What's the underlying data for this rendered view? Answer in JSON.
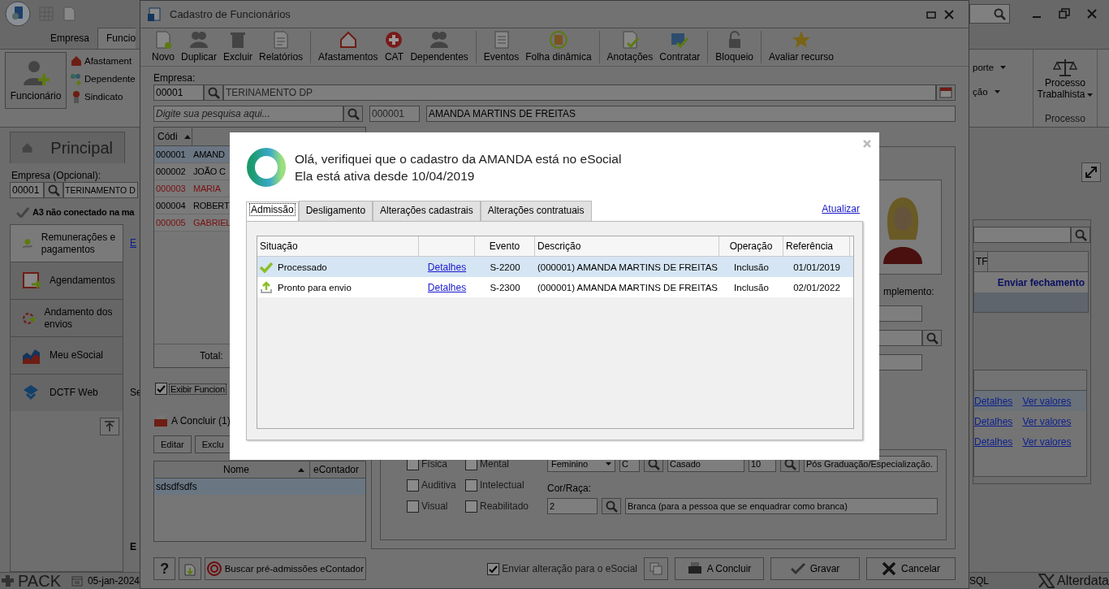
{
  "app": {
    "ribbon_tabs": [
      {
        "label": "Empresa",
        "selected": false
      },
      {
        "label": "Funcio",
        "selected": true
      }
    ],
    "ribbon_left": {
      "big_button": "Funcionário",
      "items": [
        "Afastament",
        "Dependente",
        "Sindicato"
      ]
    },
    "ribbon_right": {
      "items": [
        "porte",
        "ção"
      ],
      "big_button": "Processo Trabalhista",
      "group": "Processo"
    },
    "panel": {
      "title": "Principal",
      "company_label": "Empresa (Opcional):",
      "company_code": "00001",
      "company_name": "TERINAMENTO D",
      "status": "A3 não conectado na ma",
      "nav": [
        {
          "label": "Remunerações e pagamentos",
          "selected": true
        },
        {
          "label": "Agendamentos",
          "selected": false
        },
        {
          "label": "Andamento dos envios",
          "selected": false
        },
        {
          "label": "Meu eSocial",
          "selected": false
        },
        {
          "label": "DCTF Web",
          "selected": false
        }
      ],
      "fragments": [
        "E",
        "Se",
        "E"
      ]
    },
    "right_panel": {
      "columns": [
        "TF"
      ],
      "action": "Enviar fechamento",
      "links": [
        {
          "details": "Detalhes",
          "values": "Ver valores"
        },
        {
          "details": "Detalhes",
          "values": "Ver valores"
        },
        {
          "details": "Detalhes",
          "values": "Ver valores"
        }
      ]
    },
    "status_bar": {
      "brand": "PACK",
      "date": "05-jan-2024",
      "db": "SQL",
      "vendor": "Alterdata"
    }
  },
  "window": {
    "title": "Cadastro de Funcionários",
    "toolbar": [
      {
        "label": "Novo",
        "divider_before": false
      },
      {
        "label": "Duplicar",
        "divider_before": false
      },
      {
        "label": "Excluir",
        "divider_before": false
      },
      {
        "label": "Relatórios",
        "divider_before": false
      },
      {
        "label": "Afastamentos",
        "divider_before": true
      },
      {
        "label": "CAT",
        "divider_before": false
      },
      {
        "label": "Dependentes",
        "divider_before": false
      },
      {
        "label": "Eventos",
        "divider_before": true
      },
      {
        "label": "Folha dinâmica",
        "divider_before": false
      },
      {
        "label": "Anotações",
        "divider_before": true
      },
      {
        "label": "Contratar",
        "divider_before": false
      },
      {
        "label": "Bloqueio",
        "divider_before": true
      },
      {
        "label": "Avaliar recurso",
        "divider_before": true
      }
    ],
    "company_label": "Empresa:",
    "company_code": "00001",
    "company_name": "TERINAMENTO DP",
    "search_placeholder": "Digite sua pesquisa aqui...",
    "employee_code": "000001",
    "employee_name": "AMANDA MARTINS DE FREITAS",
    "list": {
      "column": "Códi",
      "rows": [
        {
          "code": "000001",
          "name": "AMAND",
          "color": "#000000",
          "selected": true
        },
        {
          "code": "000002",
          "name": "JOÃO C",
          "color": "#000000",
          "selected": false
        },
        {
          "code": "000003",
          "name": "MARIA",
          "color": "#7a1010",
          "selected": false
        },
        {
          "code": "000004",
          "name": "ROBERT",
          "color": "#000000",
          "selected": false
        },
        {
          "code": "000005",
          "name": "GABRIEL",
          "color": "#7a1010",
          "selected": false
        }
      ],
      "total": "Total:"
    },
    "show_checkbox": {
      "label": "Exibir Funcion",
      "checked": true
    },
    "pending": {
      "title": "A Concluir (1)",
      "buttons": [
        "Editar",
        "Exclu"
      ],
      "columns": [
        "Nome",
        "eContador"
      ],
      "rows": [
        "sdsdfsdfs"
      ]
    },
    "footer_left": {
      "help": "?",
      "import_button": "Buscar pré-admissões eContador"
    },
    "photo_label": "mplemento:",
    "form": {
      "row1": [
        {
          "label": "Física",
          "checked": false
        },
        {
          "label": "Mental",
          "checked": false
        }
      ],
      "sex": "Feminino",
      "civil_code": "C",
      "civil": "Casado",
      "education_code": "10",
      "education": "Pós Graduação/Especialização.",
      "row2": [
        {
          "label": "Auditiva",
          "checked": false
        },
        {
          "label": "Intelectual",
          "checked": false
        }
      ],
      "race_label": "Cor/Raça:",
      "row3": [
        {
          "label": "Visual",
          "checked": false
        },
        {
          "label": "Reabilitado",
          "checked": false
        }
      ],
      "race_code": "2",
      "race": "Branca (para a pessoa que se enquadrar como branca)"
    },
    "footer": {
      "send_checkbox": {
        "label": "Enviar alteração para o eSocial",
        "checked": true
      },
      "buttons": [
        "A Concluir",
        "Gravar",
        "Cancelar"
      ]
    }
  },
  "dialog": {
    "message": [
      "Olá, verifiquei que o cadastro da AMANDA está no eSocial",
      "Ela está ativa desde 10/04/2019"
    ],
    "tabs": [
      {
        "label": "Admissão",
        "selected": true
      },
      {
        "label": "Desligamento",
        "selected": false
      },
      {
        "label": "Alterações cadastrais",
        "selected": false
      },
      {
        "label": "Alterações contratuais",
        "selected": false
      }
    ],
    "refresh": "Atualizar",
    "table": {
      "columns": [
        "Situação",
        "",
        "Evento",
        "Descrição",
        "Operação",
        "Referência"
      ],
      "rows": [
        {
          "kind": "processed",
          "status": "Processado",
          "link": "Detalhes",
          "event": "S-2200",
          "description": "(000001) AMANDA MARTINS DE FREITAS",
          "operation": "Inclusão",
          "reference": "01/01/2019",
          "selected": true
        },
        {
          "kind": "ready",
          "status": "Pronto para envio",
          "link": "Detalhes",
          "event": "S-2300",
          "description": "(000001) AMANDA MARTINS DE FREITAS",
          "operation": "Inclusão",
          "reference": "02/01/2022",
          "selected": false
        }
      ]
    }
  }
}
